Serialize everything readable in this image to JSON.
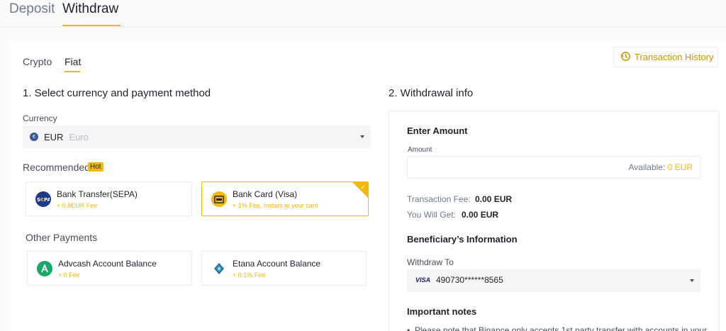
{
  "top_tabs": [
    {
      "label": "Deposit",
      "active": false
    },
    {
      "label": "Withdraw",
      "active": true
    }
  ],
  "sub_tabs": [
    {
      "label": "Crypto",
      "active": false
    },
    {
      "label": "Fiat",
      "active": true
    }
  ],
  "history_button": {
    "label": "Transaction History",
    "icon": "history-icon"
  },
  "step1": {
    "title": "1. Select currency and payment method",
    "currency_label": "Currency",
    "currency": {
      "code": "EUR",
      "name": "Euro",
      "icon": "euro-coin-icon"
    },
    "recommended_label": "Recommended",
    "hot_badge": "Hot",
    "recommended": [
      {
        "name": "Bank Transfer(SEPA)",
        "fee": "+ 0.8EUR Fee",
        "icon": "sepa-icon",
        "selected": false
      },
      {
        "name": "Bank Card (Visa)",
        "fee": "+ 1% Fee, Instant to your card",
        "icon": "card-icon",
        "selected": true
      }
    ],
    "other_label": "Other Payments",
    "other": [
      {
        "name": "Advcash Account Balance",
        "fee": "+ 0 Fee",
        "icon": "advcash-icon"
      },
      {
        "name": "Etana Account Balance",
        "fee": "+ 0.1% Fee",
        "icon": "etana-icon"
      }
    ]
  },
  "step2": {
    "title": "2. Withdrawal info",
    "enter_amount_heading": "Enter Amount",
    "amount_label": "Amount",
    "amount_value": "",
    "available_label": "Available:",
    "available_value": "0 EUR",
    "transaction_fee_label": "Transaction Fee:",
    "transaction_fee_value": "0.00 EUR",
    "you_will_get_label": "You Will Get:",
    "you_will_get_value": "0.00 EUR",
    "beneficiary_heading": "Beneficiary’s Information",
    "withdraw_to_label": "Withdraw To",
    "card_brand": "VISA",
    "card_number": "490730******8565",
    "important_notes_heading": "Important notes",
    "note_1": "Please note that Binance only accepts 1st party transfer with accounts in your"
  },
  "colors": {
    "accent": "#f0b90b",
    "accent_text": "#c99400",
    "text": "#1e2329",
    "muted": "#707a8a"
  }
}
